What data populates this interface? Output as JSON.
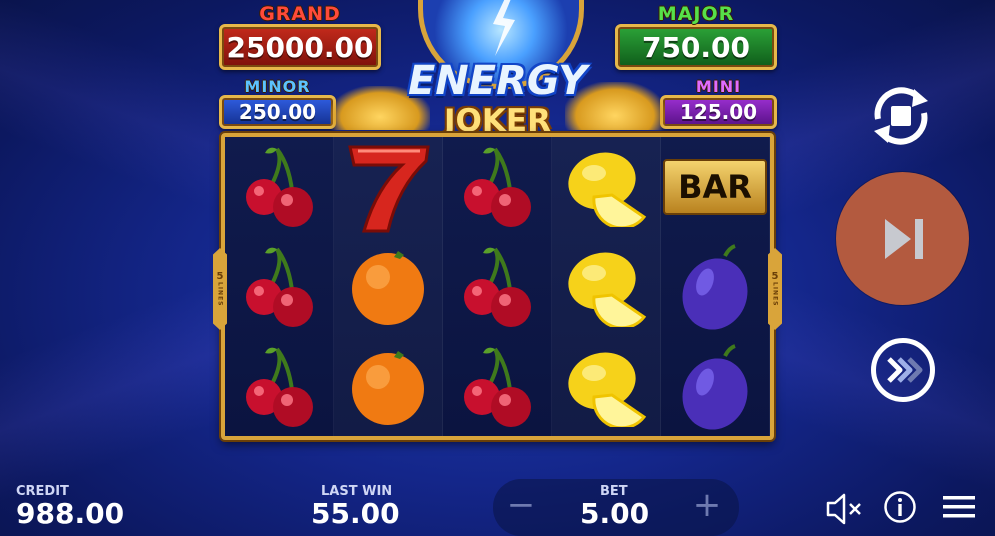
{
  "jackpots": {
    "grand": {
      "label": "GRAND",
      "value": "25000.00"
    },
    "major": {
      "label": "MAJOR",
      "value": "750.00"
    },
    "minor": {
      "label": "MINOR",
      "value": "250.00"
    },
    "mini": {
      "label": "MINI",
      "value": "125.00"
    }
  },
  "logo": {
    "line1": "ENERGY",
    "line2": "JOKER"
  },
  "lines_tag": {
    "number": "5",
    "word": "LINES"
  },
  "reels": [
    [
      "cherry-icon",
      "cherry-icon",
      "cherry-icon"
    ],
    [
      "seven-icon",
      "orange-icon",
      "orange-icon"
    ],
    [
      "cherry-icon",
      "cherry-icon",
      "cherry-icon"
    ],
    [
      "lemon-icon",
      "lemon-icon",
      "lemon-icon"
    ],
    [
      "bar-icon",
      "plum-icon",
      "plum-icon"
    ]
  ],
  "bar_symbol_text": "BAR",
  "credit": {
    "label": "CREDIT",
    "value": "988.00"
  },
  "last_win": {
    "label": "LAST WIN",
    "value": "55.00"
  },
  "bet": {
    "label": "BET",
    "value": "5.00",
    "minus": "−",
    "plus": "+"
  },
  "colors": {
    "spin_button": "#b35a3f",
    "frame_gold": "#d9a43a"
  }
}
